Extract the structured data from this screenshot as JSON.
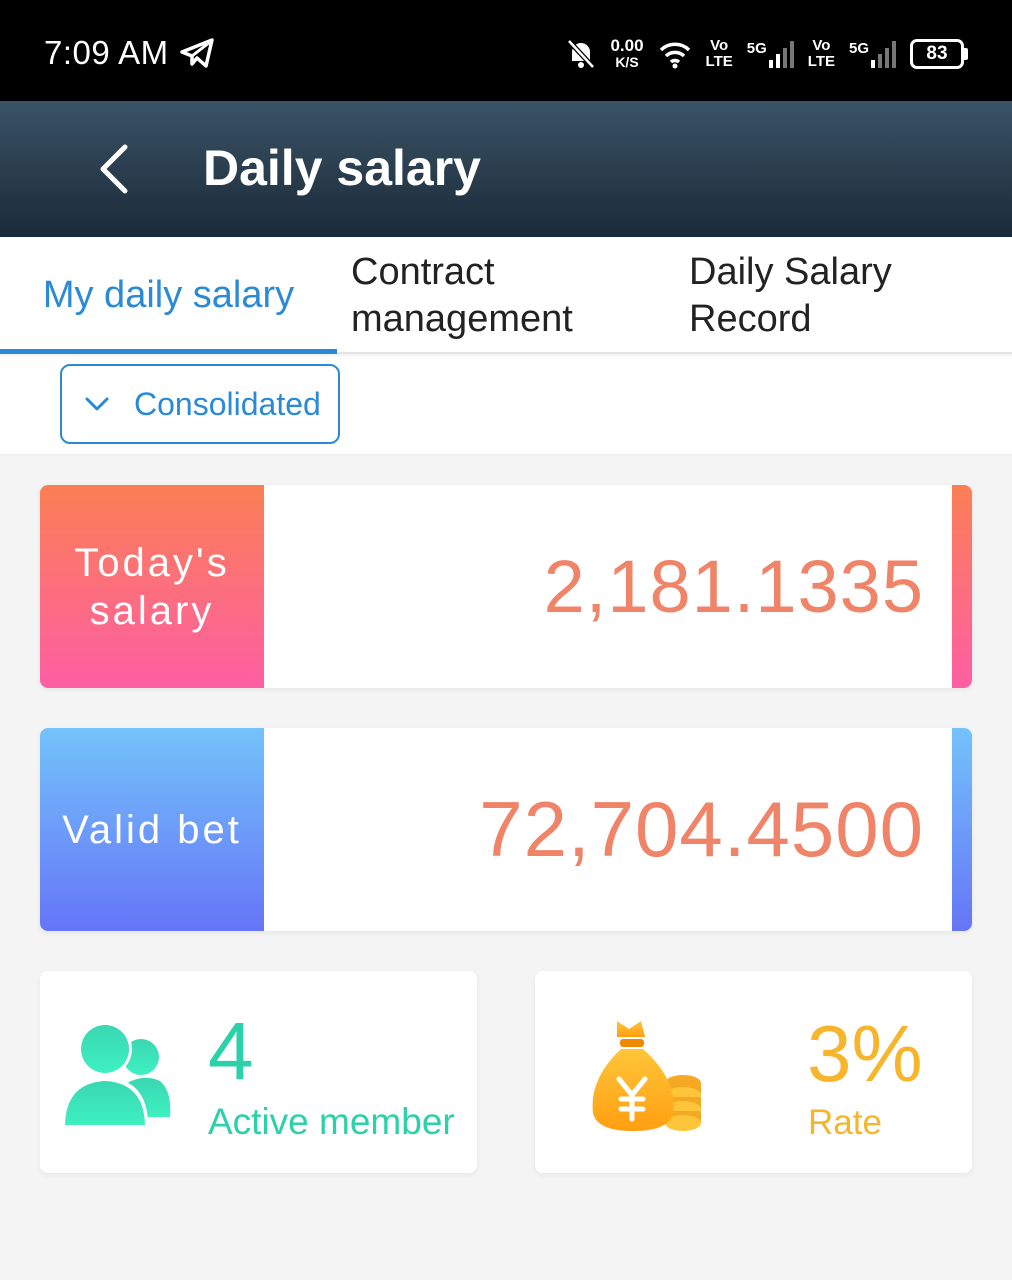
{
  "status_bar": {
    "time": "7:09 AM",
    "speed_value": "0.00",
    "speed_unit": "K/S",
    "volte_top": "Vo",
    "volte_bottom": "LTE",
    "network_label": "5G",
    "battery": "83"
  },
  "header": {
    "title": "Daily salary"
  },
  "tabs": [
    {
      "label": "My daily salary"
    },
    {
      "label": "Contract management"
    },
    {
      "label": "Daily Salary Record"
    }
  ],
  "filter": {
    "selected": "Consolidated"
  },
  "cards": {
    "salary": {
      "label": "Today's salary",
      "value": "2,181.1335"
    },
    "bet": {
      "label": "Valid bet",
      "value": "72,704.4500"
    }
  },
  "stats": {
    "members": {
      "value": "4",
      "label": "Active member"
    },
    "rate": {
      "value": "3%",
      "label": "Rate"
    }
  },
  "colors": {
    "accent_blue": "#2a8ad6",
    "value_orange": "#f08468",
    "member_green": "#2bd1a9",
    "rate_gold": "#f7b52c"
  }
}
